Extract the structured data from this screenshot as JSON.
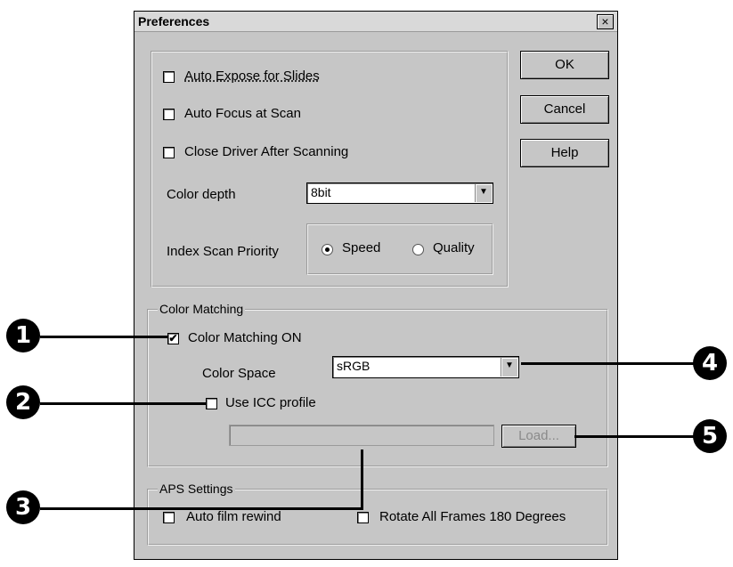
{
  "window": {
    "title": "Preferences",
    "close_glyph": "×"
  },
  "buttons": {
    "ok": "OK",
    "cancel": "Cancel",
    "help": "Help",
    "load": "Load..."
  },
  "options": {
    "auto_expose": {
      "label": "Auto Expose for Slides",
      "checked": false
    },
    "auto_focus": {
      "label": "Auto Focus at Scan",
      "checked": false
    },
    "close_driver": {
      "label": "Close Driver After Scanning",
      "checked": false
    }
  },
  "color_depth": {
    "label": "Color depth",
    "value": "8bit"
  },
  "index_scan": {
    "label": "Index Scan Priority",
    "option_speed": "Speed",
    "option_quality": "Quality",
    "selected": "Speed"
  },
  "color_matching": {
    "group_title": "Color Matching",
    "on_label": "Color Matching ON",
    "on_checked": true,
    "color_space_label": "Color Space",
    "color_space_value": "sRGB",
    "icc_label": "Use ICC profile",
    "icc_checked": false,
    "icc_path": ""
  },
  "aps": {
    "group_title": "APS Settings",
    "auto_rewind_label": "Auto film rewind",
    "rotate_label": "Rotate All Frames 180 Degrees"
  },
  "callouts": [
    "1",
    "2",
    "3",
    "4",
    "5"
  ],
  "icons": {
    "checkmark": "✔",
    "dropdown": "▼"
  }
}
